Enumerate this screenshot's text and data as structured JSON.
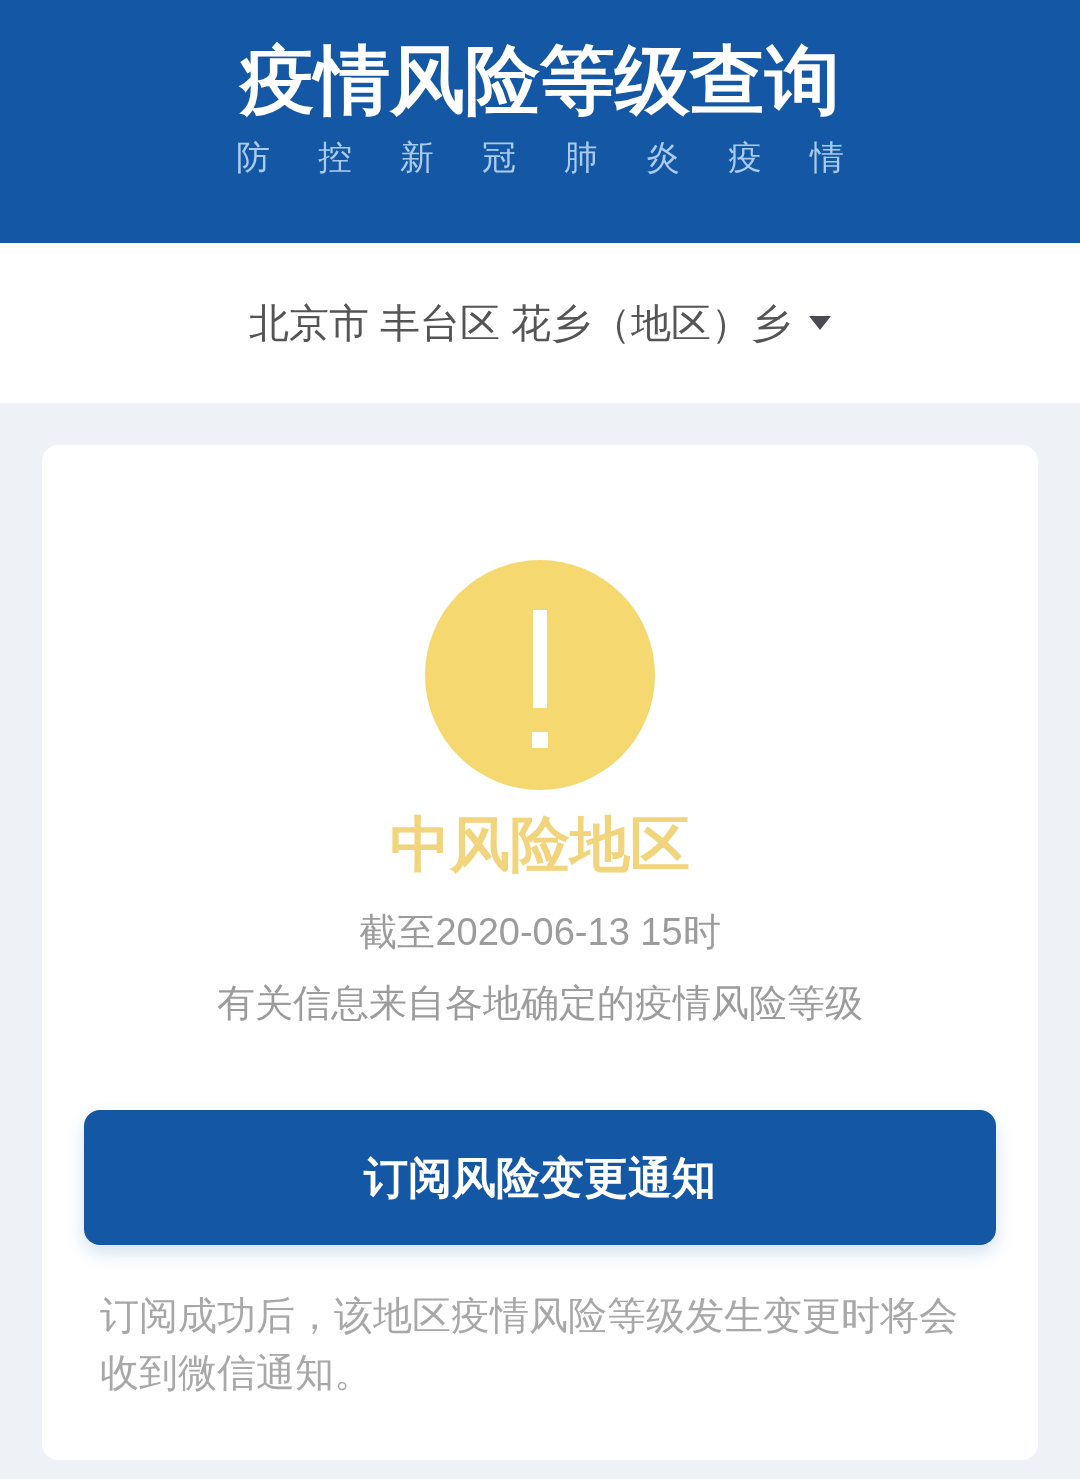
{
  "header": {
    "title": "疫情风险等级查询",
    "subtitle": "防控新冠肺炎疫情"
  },
  "location": {
    "text": "北京市 丰台区 花乡（地区）乡"
  },
  "risk": {
    "kind": "medium",
    "label": "中风险地区",
    "updated": "截至2020-06-13 15时",
    "source_note": "有关信息来自各地确定的疫情风险等级"
  },
  "subscribe_button": {
    "label": "订阅风险变更通知"
  },
  "note": "订阅成功后，该地区疫情风险等级发生变更时将会收到微信通知。"
}
